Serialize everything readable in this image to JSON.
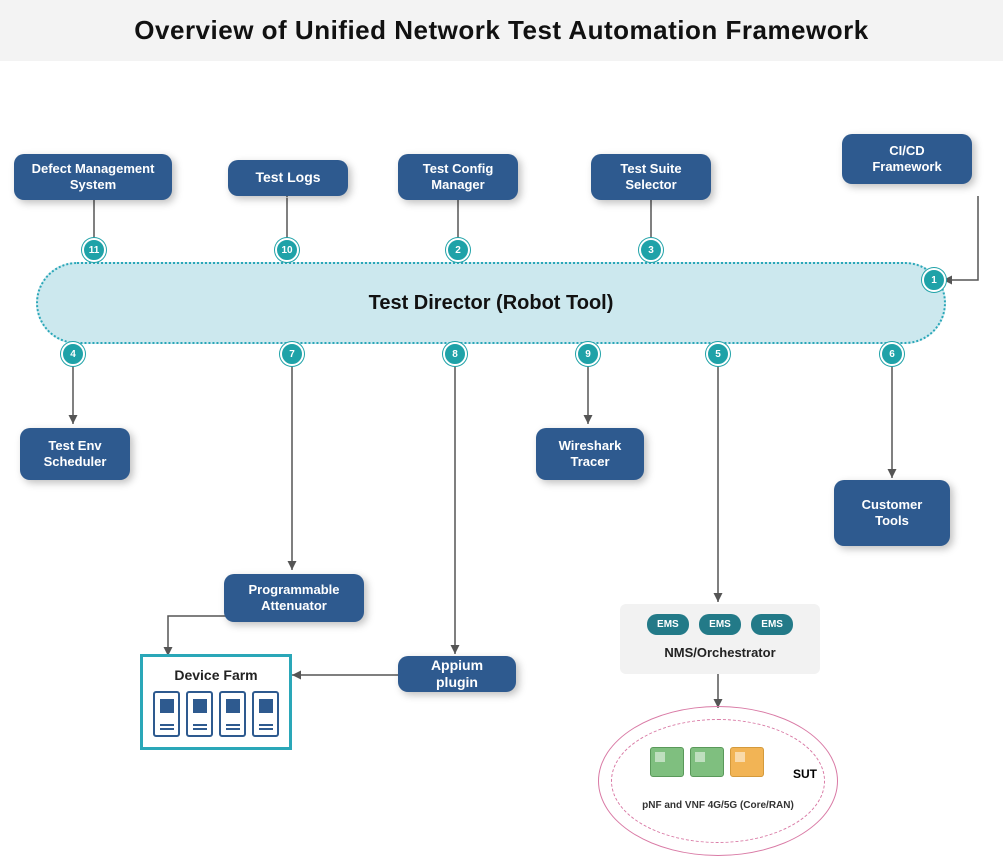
{
  "title": "Overview of Unified Network Test Automation Framework",
  "main_node": {
    "label": "Test Director (Robot Tool)"
  },
  "boxes": {
    "defect": "Defect Management System",
    "logs": "Test Logs",
    "config": "Test Config Manager",
    "suite": "Test Suite Selector",
    "cicd": "CI/CD Framework",
    "env": "Test Env Scheduler",
    "atten": "Programmable Attenuator",
    "appium": "Appium plugin",
    "wireshark": "Wireshark Tracer",
    "customer": "Customer Tools"
  },
  "badges": {
    "1": "1",
    "2": "2",
    "3": "3",
    "4": "4",
    "5": "5",
    "6": "6",
    "7": "7",
    "8": "8",
    "9": "9",
    "10": "10",
    "11": "11"
  },
  "nms": {
    "ems": "EMS",
    "label": "NMS/Orchestrator"
  },
  "sut": {
    "label": "SUT",
    "sub": "pNF and VNF 4G/5G (Core/RAN)"
  },
  "device_farm": {
    "title": "Device Farm"
  },
  "colors": {
    "box": "#2e5a8f",
    "pill_bg": "#cce8ee",
    "pill_border": "#2aa7b8",
    "badge": "#1fa2a8",
    "sut_border": "#d97aa5"
  }
}
